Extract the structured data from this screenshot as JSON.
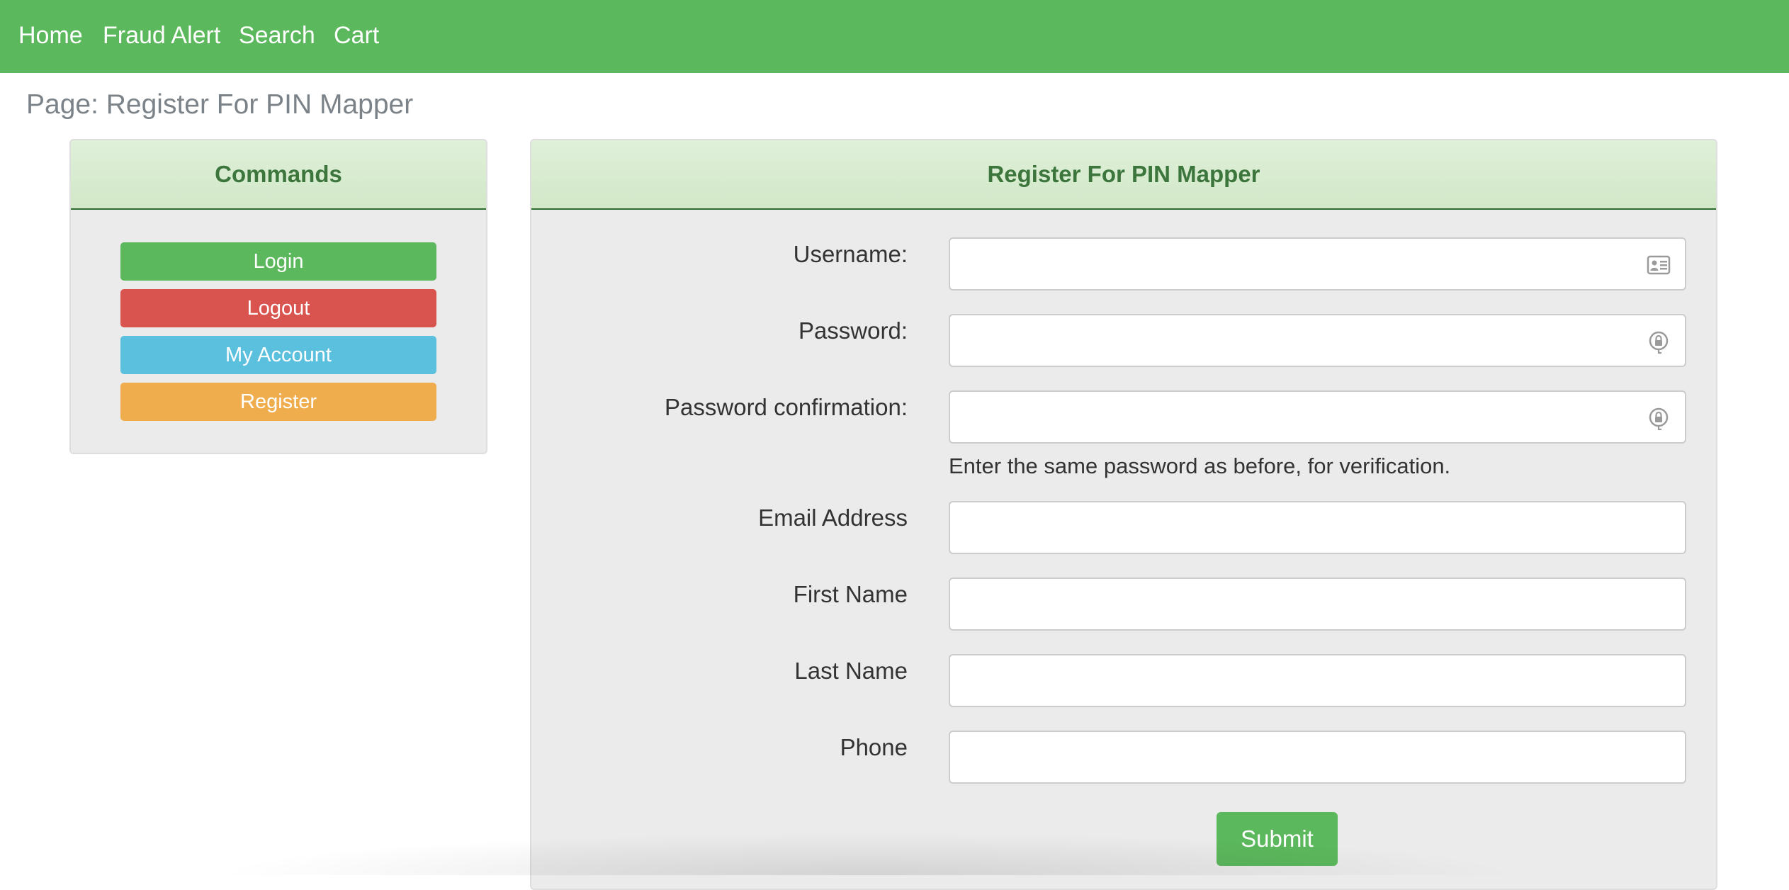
{
  "nav": {
    "links": [
      "Home",
      "Fraud Alert",
      "Search",
      "Cart"
    ]
  },
  "page_title": "Page: Register For PIN Mapper",
  "commands": {
    "heading": "Commands",
    "buttons": [
      {
        "label": "Login",
        "color": "#5cb85c"
      },
      {
        "label": "Logout",
        "color": "#d9534f"
      },
      {
        "label": "My Account",
        "color": "#5bc0de"
      },
      {
        "label": "Register",
        "color": "#f0ad4e"
      }
    ]
  },
  "form": {
    "heading": "Register For PIN Mapper",
    "fields": {
      "username": {
        "label": "Username:",
        "value": "",
        "icon": "contact-card-icon"
      },
      "password": {
        "label": "Password:",
        "value": "",
        "icon": "key-lock-icon"
      },
      "password_confirmation": {
        "label": "Password confirmation:",
        "value": "",
        "icon": "key-lock-icon"
      },
      "email": {
        "label": "Email Address",
        "value": ""
      },
      "first_name": {
        "label": "First Name",
        "value": ""
      },
      "last_name": {
        "label": "Last Name",
        "value": ""
      },
      "phone": {
        "label": "Phone",
        "value": ""
      }
    },
    "password_confirmation_help": "Enter the same password as before, for verification.",
    "submit_label": "Submit"
  },
  "colors": {
    "nav_background": "#5cb85c",
    "panel_heading_text": "#3c763d",
    "panel_background": "#ebebeb"
  }
}
